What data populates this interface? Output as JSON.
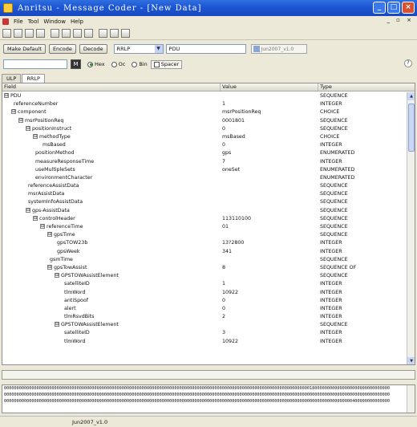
{
  "window": {
    "title": "Anritsu - Message Coder - [New Data]",
    "controls": [
      "_",
      "□",
      "×"
    ]
  },
  "menu": {
    "items": [
      "File",
      "Tool",
      "Window",
      "Help"
    ],
    "mdi_controls": "_ ▫ ×"
  },
  "toolbar_icons": [
    "new-icon",
    "open-icon",
    "save-icon",
    "copy-icon",
    "paste-icon",
    "print-icon",
    "preview-icon",
    "settings-icon",
    "grid-icon",
    "list-icon",
    "window-icon"
  ],
  "controls": {
    "make_default": "Make Default",
    "encode": "Encode",
    "decode": "Decode",
    "protocol": "RRLP",
    "message": "PDU",
    "version": "Jun2007_v1.0"
  },
  "options": {
    "search_value": "",
    "find_glyph": "M",
    "radio_hex": "Hex",
    "radio_oct": "Oc",
    "radio_bin": "Bin",
    "spacer": "Spacer",
    "help": "?"
  },
  "tabs": [
    "ULP",
    "RRLP"
  ],
  "grid": {
    "headers": {
      "field": "Field",
      "value": "Value",
      "type": "Type"
    },
    "rows": [
      {
        "depth": 0,
        "toggle": "⊟",
        "field": "PDU",
        "value": "",
        "type": "SEQUENCE"
      },
      {
        "depth": 1,
        "toggle": "",
        "field": "referenceNumber",
        "value": "1",
        "type": "INTEGER"
      },
      {
        "depth": 1,
        "toggle": "⊟",
        "field": "component",
        "value": "msrPositionReq",
        "type": "CHOICE"
      },
      {
        "depth": 2,
        "toggle": "⊟",
        "field": "msrPositionReq",
        "value": "0001801",
        "type": "SEQUENCE"
      },
      {
        "depth": 3,
        "toggle": "⊟",
        "field": "positionInstruct",
        "value": "0",
        "type": "SEQUENCE"
      },
      {
        "depth": 4,
        "toggle": "⊟",
        "field": "methodType",
        "value": "msBased",
        "type": "CHOICE"
      },
      {
        "depth": 5,
        "toggle": "",
        "field": "msBased",
        "value": "0",
        "type": "INTEGER"
      },
      {
        "depth": 4,
        "toggle": "",
        "field": "positionMethod",
        "value": "gps",
        "type": "ENUMERATED"
      },
      {
        "depth": 4,
        "toggle": "",
        "field": "measureResponseTime",
        "value": "7",
        "type": "INTEGER"
      },
      {
        "depth": 4,
        "toggle": "",
        "field": "useMultipleSets",
        "value": "oneSet",
        "type": "ENUMERATED"
      },
      {
        "depth": 4,
        "toggle": "",
        "field": "environmentCharacter",
        "value": "",
        "type": "ENUMERATED"
      },
      {
        "depth": 3,
        "toggle": "",
        "field": "referenceAssistData",
        "value": "",
        "type": "SEQUENCE"
      },
      {
        "depth": 3,
        "toggle": "",
        "field": "msrAssistData",
        "value": "",
        "type": "SEQUENCE"
      },
      {
        "depth": 3,
        "toggle": "",
        "field": "systemInfoAssistData",
        "value": "",
        "type": "SEQUENCE"
      },
      {
        "depth": 3,
        "toggle": "⊟",
        "field": "gps-AssistData",
        "value": "",
        "type": "SEQUENCE"
      },
      {
        "depth": 4,
        "toggle": "⊟",
        "field": "controlHeader",
        "value": "113110100",
        "type": "SEQUENCE"
      },
      {
        "depth": 5,
        "toggle": "⊟",
        "field": "referenceTime",
        "value": "01",
        "type": "SEQUENCE"
      },
      {
        "depth": 6,
        "toggle": "⊟",
        "field": "gpsTime",
        "value": "",
        "type": "SEQUENCE"
      },
      {
        "depth": 7,
        "toggle": "",
        "field": "gpsTOW23b",
        "value": "13?2800",
        "type": "INTEGER"
      },
      {
        "depth": 7,
        "toggle": "",
        "field": "gpsWeek",
        "value": "341",
        "type": "INTEGER"
      },
      {
        "depth": 6,
        "toggle": "",
        "field": "gsmTime",
        "value": "",
        "type": "SEQUENCE"
      },
      {
        "depth": 6,
        "toggle": "⊟",
        "field": "gpsTowAssist",
        "value": "8",
        "type": "SEQUENCE OF"
      },
      {
        "depth": 7,
        "toggle": "⊟",
        "field": "GPSTOWAssistElement",
        "value": "",
        "type": "SEQUENCE"
      },
      {
        "depth": 8,
        "toggle": "",
        "field": "satelliteID",
        "value": "1",
        "type": "INTEGER"
      },
      {
        "depth": 8,
        "toggle": "",
        "field": "tlmWord",
        "value": "10922",
        "type": "INTEGER"
      },
      {
        "depth": 8,
        "toggle": "",
        "field": "antiSpoof",
        "value": "0",
        "type": "INTEGER"
      },
      {
        "depth": 8,
        "toggle": "",
        "field": "alert",
        "value": "0",
        "type": "INTEGER"
      },
      {
        "depth": 8,
        "toggle": "",
        "field": "tlmRsvdBits",
        "value": "2",
        "type": "INTEGER"
      },
      {
        "depth": 7,
        "toggle": "⊟",
        "field": "GPSTOWAssistElement",
        "value": "",
        "type": "SEQUENCE"
      },
      {
        "depth": 8,
        "toggle": "",
        "field": "satelliteID",
        "value": "3",
        "type": "INTEGER"
      },
      {
        "depth": 8,
        "toggle": "",
        "field": "tlmWord",
        "value": "10922",
        "type": "INTEGER"
      }
    ]
  },
  "hex_lines": [
    "0000000000000000000000000000000000000000000000000000000000000000000000000000000000000000000000000000000000000000000000000018000000000000000000000000000000",
    "0000000000000000000000000000000000000000000000000000000000000000000000000000000000000000000000000000000000000000000000000000000000000000000000000000000000",
    "0000000000000000000000000000000000000000000000000000000000000000000000000000000000000000000000000000000000000000000000000000000000000000000400000000000000"
  ],
  "status": {
    "version": "Jun2007_v1.0"
  }
}
